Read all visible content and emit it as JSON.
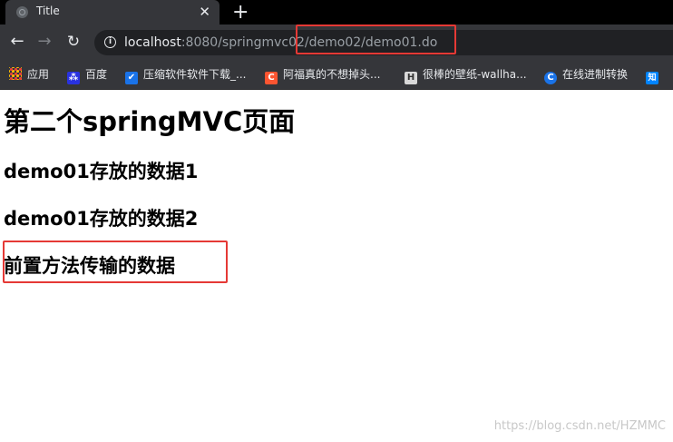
{
  "tab": {
    "title": "Title",
    "close_glyph": "✕",
    "new_tab_glyph": "+"
  },
  "toolbar": {
    "back_glyph": "←",
    "forward_glyph": "→",
    "reload_glyph": "↻",
    "info_glyph": "i",
    "url_host": "localhost",
    "url_path": ":8080/springmvc02/demo02/demo01.do"
  },
  "bookmarks": [
    {
      "label": "应用",
      "icon": "apps-grid-icon"
    },
    {
      "label": "百度",
      "icon": "baidu-paw-icon",
      "color": "#2932e1"
    },
    {
      "label": "压缩软件软件下载_...",
      "icon": "compress-software-icon",
      "color": "#1a73e8"
    },
    {
      "label": "阿福真的不想掉头...",
      "icon": "csdn-c-icon",
      "color": "#fc5531",
      "glyph": "C"
    },
    {
      "label": "很棒的壁纸-wallha...",
      "icon": "wallhaven-icon",
      "color": "#d9d9d9",
      "glyph": "H"
    },
    {
      "label": "在线进制转换",
      "icon": "converter-c-icon",
      "color": "#1a73e8",
      "glyph": "C"
    },
    {
      "label": "知",
      "icon": "zhihu-icon",
      "color": "#0084ff",
      "glyph": "知"
    }
  ],
  "page": {
    "heading": "第二个springMVC页面",
    "lines": [
      "demo01存放的数据1",
      "demo01存放的数据2",
      "前置方法传输的数据"
    ]
  },
  "annotation_color": "#e53935",
  "watermark": "https://blog.csdn.net/HZMMC"
}
